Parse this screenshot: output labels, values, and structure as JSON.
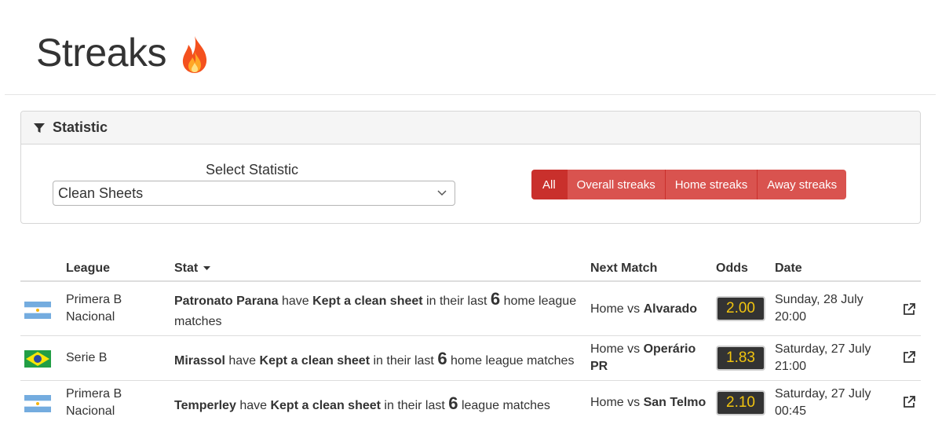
{
  "page": {
    "title": "Streaks"
  },
  "filter_panel": {
    "heading": "Statistic",
    "select_label": "Select Statistic",
    "select_value": "Clean Sheets",
    "buttons": [
      "All",
      "Overall streaks",
      "Home streaks",
      "Away streaks"
    ],
    "active_button": "All"
  },
  "table": {
    "headers": {
      "league": "League",
      "stat": "Stat",
      "next_match": "Next Match",
      "odds": "Odds",
      "date": "Date"
    },
    "rows": [
      {
        "flag": "argentina",
        "league_line1": "Primera B",
        "league_line2": "Nacional",
        "team": "Patronato Parana",
        "word_have": "have",
        "stat": "Kept a clean sheet",
        "pre": "in their last",
        "count": "6",
        "post_a": "home league",
        "post_b": "matches",
        "match_pre": "Home vs",
        "opponent_a": "Alvarado",
        "opponent_b": "",
        "odds": "2.00",
        "date_line1": "Sunday, 28 July",
        "date_line2": "20:00"
      },
      {
        "flag": "brazil",
        "league_line1": "Serie B",
        "league_line2": "",
        "team": "Mirassol",
        "word_have": "have",
        "stat": "Kept a clean sheet",
        "pre": "in their last",
        "count": "6",
        "post_a": "home league matches",
        "post_b": "",
        "match_pre": "Home vs",
        "opponent_a": "Operário",
        "opponent_b": "PR",
        "odds": "1.83",
        "date_line1": "Saturday, 27 July",
        "date_line2": "21:00"
      },
      {
        "flag": "argentina",
        "league_line1": "Primera B",
        "league_line2": "Nacional",
        "team": "Temperley",
        "word_have": "have",
        "stat": "Kept a clean sheet",
        "pre": "in their last",
        "count": "6",
        "post_a": "league matches",
        "post_b": "",
        "match_pre": "Home vs",
        "opponent_a": "San Telmo",
        "opponent_b": "",
        "odds": "2.10",
        "date_line1": "Saturday, 27 July",
        "date_line2": "00:45"
      }
    ]
  },
  "colors": {
    "button_red": "#d9534f",
    "button_active": "#c9302c",
    "odds_bg": "#333333",
    "odds_text": "#f1c40f"
  }
}
